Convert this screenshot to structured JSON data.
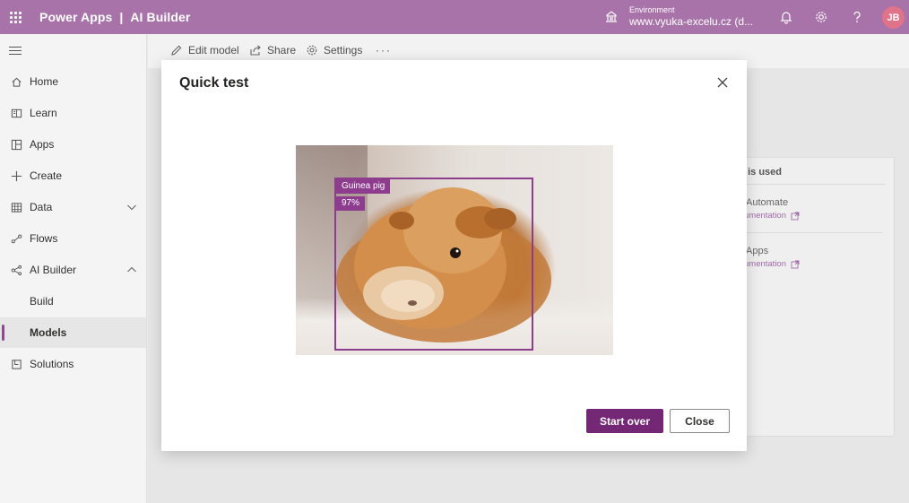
{
  "header": {
    "app_name": "Power Apps",
    "separator": "|",
    "product": "AI Builder",
    "environment_label": "Environment",
    "environment_value": "www.vyuka-excelu.cz (d...",
    "avatar_initials": "JB",
    "accent_color": "#a873a8"
  },
  "sidebar": {
    "items": [
      {
        "label": "Home",
        "icon": "home-icon"
      },
      {
        "label": "Learn",
        "icon": "book-icon"
      },
      {
        "label": "Apps",
        "icon": "apps-icon"
      },
      {
        "label": "Create",
        "icon": "plus-icon"
      },
      {
        "label": "Data",
        "icon": "table-icon"
      },
      {
        "label": "Flows",
        "icon": "flow-icon"
      },
      {
        "label": "AI Builder",
        "icon": "ai-builder-icon"
      },
      {
        "label": "Build"
      },
      {
        "label": "Models"
      },
      {
        "label": "Solutions",
        "icon": "solutions-icon"
      }
    ]
  },
  "commandbar": {
    "edit_model": "Edit model",
    "share": "Share",
    "settings": "Settings",
    "more": "···"
  },
  "card": {
    "title": "l is used",
    "items": [
      {
        "name": "Automate",
        "link": "umentation"
      },
      {
        "name": "Apps",
        "link": "umentation"
      }
    ]
  },
  "modal": {
    "title": "Quick test",
    "detection": {
      "label": "Guinea pig",
      "confidence": "97%",
      "color": "#8e3c8e"
    },
    "start_over": "Start over",
    "close": "Close",
    "primary_color": "#742774"
  }
}
